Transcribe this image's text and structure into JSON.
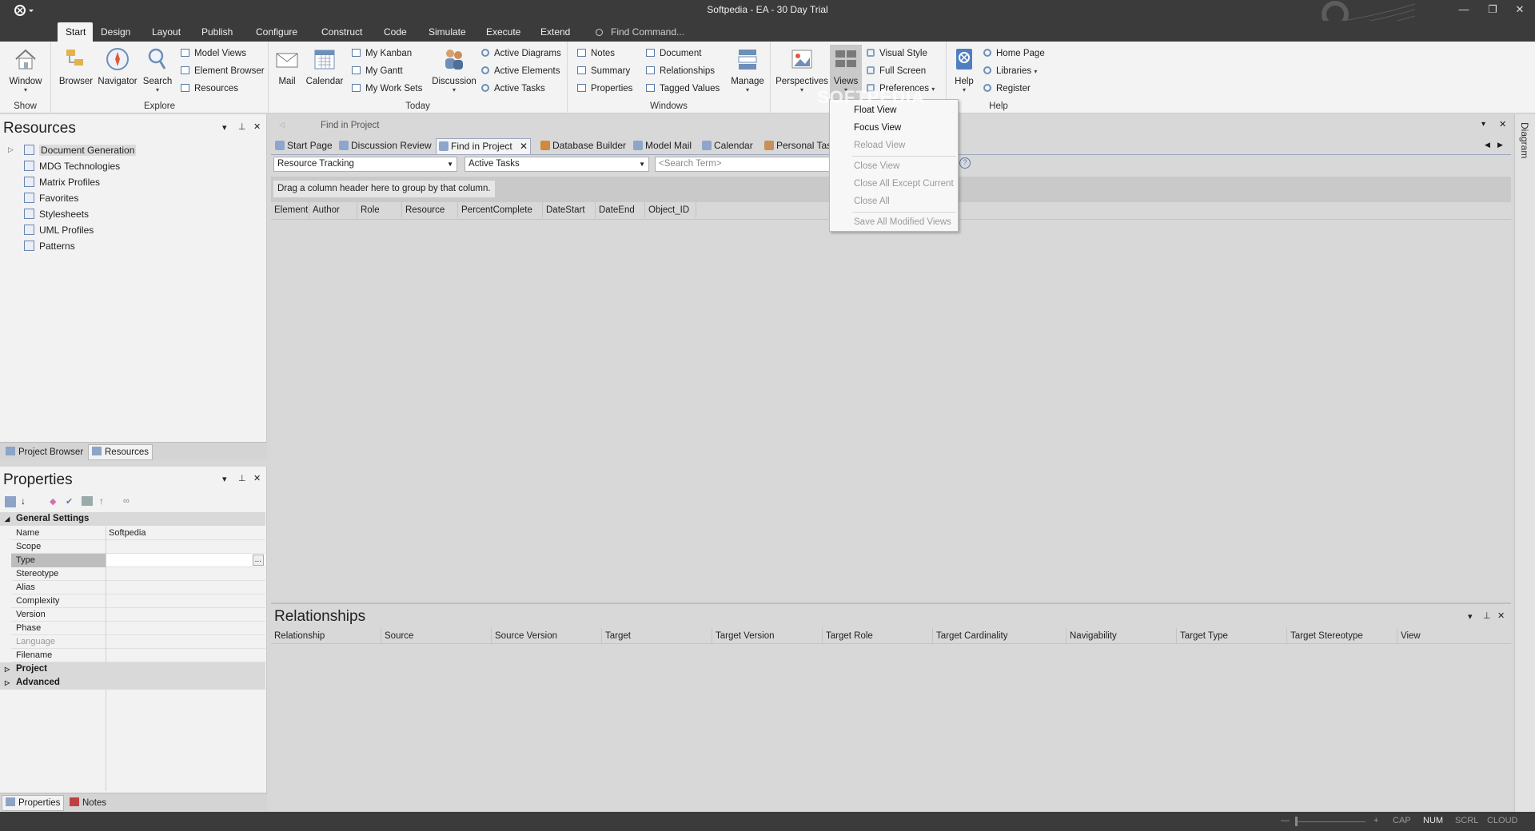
{
  "window": {
    "title": "Softpedia - EA - 30 Day Trial",
    "minimize": "—",
    "restore": "❐",
    "close": "✕"
  },
  "menu": {
    "tabs": [
      "Start",
      "Design",
      "Layout",
      "Publish",
      "Configure",
      "Construct",
      "Code",
      "Simulate",
      "Execute",
      "Extend"
    ],
    "active": "Start",
    "find_command": "Find Command..."
  },
  "ribbon": {
    "show": {
      "window_label": "Window",
      "group_label": "Show"
    },
    "explore": {
      "browser": "Browser",
      "navigator": "Navigator",
      "search": "Search",
      "model_views": "Model Views",
      "element_browser": "Element Browser",
      "resources": "Resources",
      "group_label": "Explore"
    },
    "today": {
      "mail": "Mail",
      "calendar": "Calendar",
      "my_kanban": "My Kanban",
      "my_gantt": "My Gantt",
      "my_work_sets": "My Work Sets",
      "discussion": "Discussion",
      "active_diagrams": "Active Diagrams",
      "active_elements": "Active Elements",
      "active_tasks": "Active Tasks",
      "group_label": "Today"
    },
    "windows": {
      "notes": "Notes",
      "summary": "Summary",
      "properties": "Properties",
      "document": "Document",
      "relationships": "Relationships",
      "tagged_values": "Tagged Values",
      "manage": "Manage",
      "group_label": "Windows"
    },
    "workspace": {
      "perspectives": "Perspectives",
      "views": "Views",
      "visual_style": "Visual Style",
      "full_screen": "Full Screen",
      "preferences": "Preferences"
    },
    "help": {
      "help": "Help",
      "home_page": "Home Page",
      "libraries": "Libraries",
      "register": "Register",
      "group_label": "Help"
    }
  },
  "resources_panel": {
    "title": "Resources",
    "items": [
      "Document Generation",
      "MDG Technologies",
      "Matrix Profiles",
      "Favorites",
      "Stylesheets",
      "UML Profiles",
      "Patterns"
    ],
    "tabs": [
      "Project Browser",
      "Resources"
    ]
  },
  "properties_panel": {
    "title": "Properties",
    "category_general": "General Settings",
    "rows": [
      {
        "name": "Name",
        "value": "Softpedia"
      },
      {
        "name": "Scope",
        "value": ""
      },
      {
        "name": "Type",
        "value": ""
      },
      {
        "name": "Stereotype",
        "value": ""
      },
      {
        "name": "Alias",
        "value": ""
      },
      {
        "name": "Complexity",
        "value": ""
      },
      {
        "name": "Version",
        "value": ""
      },
      {
        "name": "Phase",
        "value": ""
      },
      {
        "name": "Language",
        "value": ""
      },
      {
        "name": "Filename",
        "value": ""
      }
    ],
    "ellipsis": "...",
    "category_project": "Project",
    "category_advanced": "Advanced",
    "tabs": [
      "Properties",
      "Notes"
    ]
  },
  "main_view": {
    "breadcrumb": "Find in Project",
    "tabs": [
      "Start Page",
      "Discussion Review",
      "Find in Project",
      "Database Builder",
      "Model Mail",
      "Calendar",
      "Personal Tasks"
    ],
    "active_tab": "Find in Project",
    "search_combo": "Resource Tracking",
    "filter_combo": "Active Tasks",
    "search_placeholder": "<Search Term>",
    "group_hint": "Drag a column header here to group by that column.",
    "columns": [
      "Element",
      "Author",
      "Role",
      "Resource",
      "PercentComplete",
      "DateStart",
      "DateEnd",
      "Object_ID"
    ]
  },
  "relationships_panel": {
    "title": "Relationships",
    "columns": [
      "Relationship",
      "Source",
      "Source Version",
      "Target",
      "Target Version",
      "Target Role",
      "Target Cardinality",
      "Navigability",
      "Target Type",
      "Target Stereotype",
      "View"
    ]
  },
  "views_menu": {
    "items": [
      {
        "label": "Float View",
        "enabled": true
      },
      {
        "label": "Focus View",
        "enabled": true
      },
      {
        "label": "Reload View",
        "enabled": false
      },
      {
        "label": "Close View",
        "enabled": false
      },
      {
        "label": "Close All Except Current",
        "enabled": false
      },
      {
        "label": "Close All",
        "enabled": false
      },
      {
        "label": "Save All Modified Views",
        "enabled": false
      }
    ]
  },
  "diagram_strip": {
    "label": "Diagram"
  },
  "status_bar": {
    "minus": "—",
    "plus": "+",
    "indicators": [
      "CAP",
      "NUM",
      "SCRL",
      "CLOUD"
    ],
    "active_indicator": "NUM"
  },
  "watermark": "SOFTPEDIA"
}
